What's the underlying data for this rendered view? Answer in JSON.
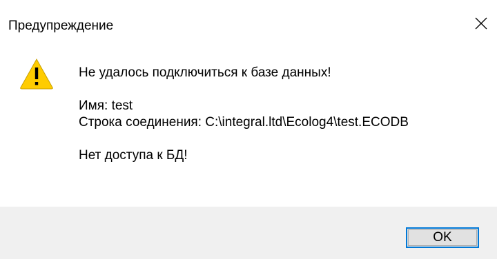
{
  "window": {
    "title": "Предупреждение",
    "close_icon": "close-icon"
  },
  "message": {
    "icon": "warning-icon",
    "line1": "Не удалось подключиться к базе данных!",
    "line2": "Имя: test",
    "line3": "Строка соединения: C:\\integral.ltd\\Ecolog4\\test.ECODB",
    "line4": "Нет доступа к БД!"
  },
  "buttons": {
    "ok_label": "OK"
  },
  "colors": {
    "focus_border": "#0078d7",
    "button_face": "#e1e1e1",
    "footer_bg": "#f0f0f0",
    "warning_fill": "#ffcc00"
  }
}
